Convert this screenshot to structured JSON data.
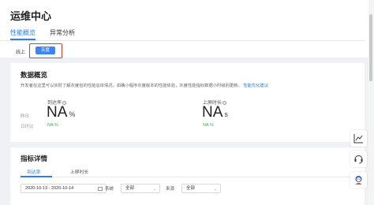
{
  "header": {
    "title": "运维中心",
    "tabs": [
      {
        "label": "性能概览",
        "active": true
      },
      {
        "label": "异常分析",
        "active": false
      }
    ]
  },
  "environment": {
    "label": "线上",
    "button_label": "灰度"
  },
  "overview": {
    "title": "数据概览",
    "description": "开发者在这里可以实时了解灰度包的性能总体情况，如确小程序灰度版本的性能体验，灰度性能指标数据小时级别更新。",
    "link_text": "性能优化建议",
    "row_labels": {
      "yesterday": "昨日",
      "day_ratio": "日环比"
    },
    "metrics": [
      {
        "label": "到达率",
        "icon": "help-icon",
        "value": "NA",
        "unit": "%",
        "ratio": "NA %"
      },
      {
        "label": "上屏时长",
        "icon": "help-icon",
        "value": "NA",
        "unit": "s",
        "ratio": "NA %"
      }
    ]
  },
  "details": {
    "title": "指标详情",
    "subtabs": [
      {
        "label": "到达率",
        "active": true
      },
      {
        "label": "上屏时长",
        "active": false
      }
    ],
    "date_range": "2020-10-13 - 2020-10-14",
    "system_label": "系统",
    "system_value": "全部",
    "source_label": "来源",
    "source_value": "全部"
  },
  "colors": {
    "accent": "#2b7cf5",
    "highlight": "#e03a2e",
    "positive": "#3bb34a"
  }
}
